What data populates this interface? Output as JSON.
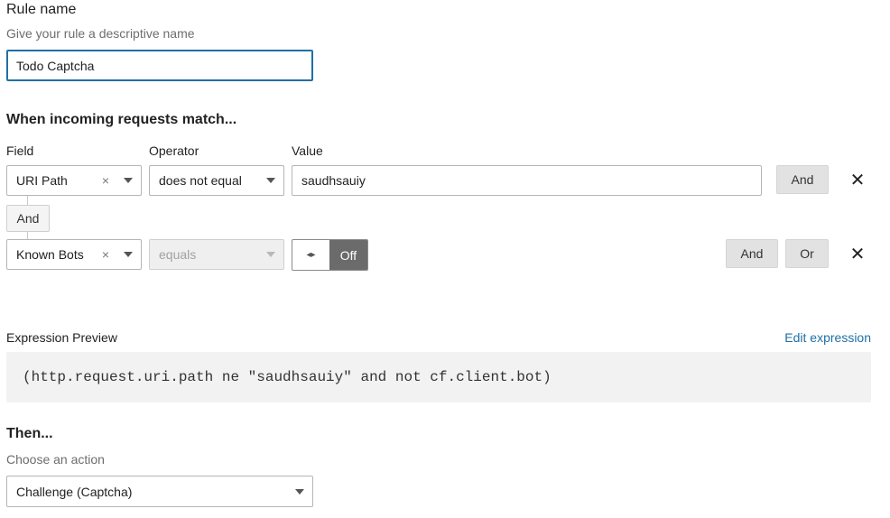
{
  "rule_name": {
    "label": "Rule name",
    "help": "Give your rule a descriptive name",
    "value": "Todo Captcha"
  },
  "match": {
    "heading": "When incoming requests match...",
    "columns": {
      "field": "Field",
      "operator": "Operator",
      "value": "Value"
    },
    "rows": [
      {
        "field": "URI Path",
        "operator": "does not equal",
        "value": "saudhsauiy",
        "and_label": "And"
      },
      {
        "field": "Known Bots",
        "operator": "equals",
        "toggle_state": "Off",
        "and_label": "And",
        "or_label": "Or"
      }
    ],
    "connector_label": "And",
    "clear_glyph": "×",
    "remove_glyph": "✕",
    "toggle_glyph": "◂▸"
  },
  "expression": {
    "label": "Expression Preview",
    "edit_link": "Edit expression",
    "code": "(http.request.uri.path ne \"saudhsauiy\" and not cf.client.bot)"
  },
  "then": {
    "heading": "Then...",
    "help": "Choose an action",
    "action": "Challenge (Captcha)"
  },
  "colors": {
    "accent": "#1f6fa6",
    "button_bg": "#e2e2e2",
    "toggle_off_bg": "#6b6b6b",
    "code_bg": "#f2f2f2"
  }
}
